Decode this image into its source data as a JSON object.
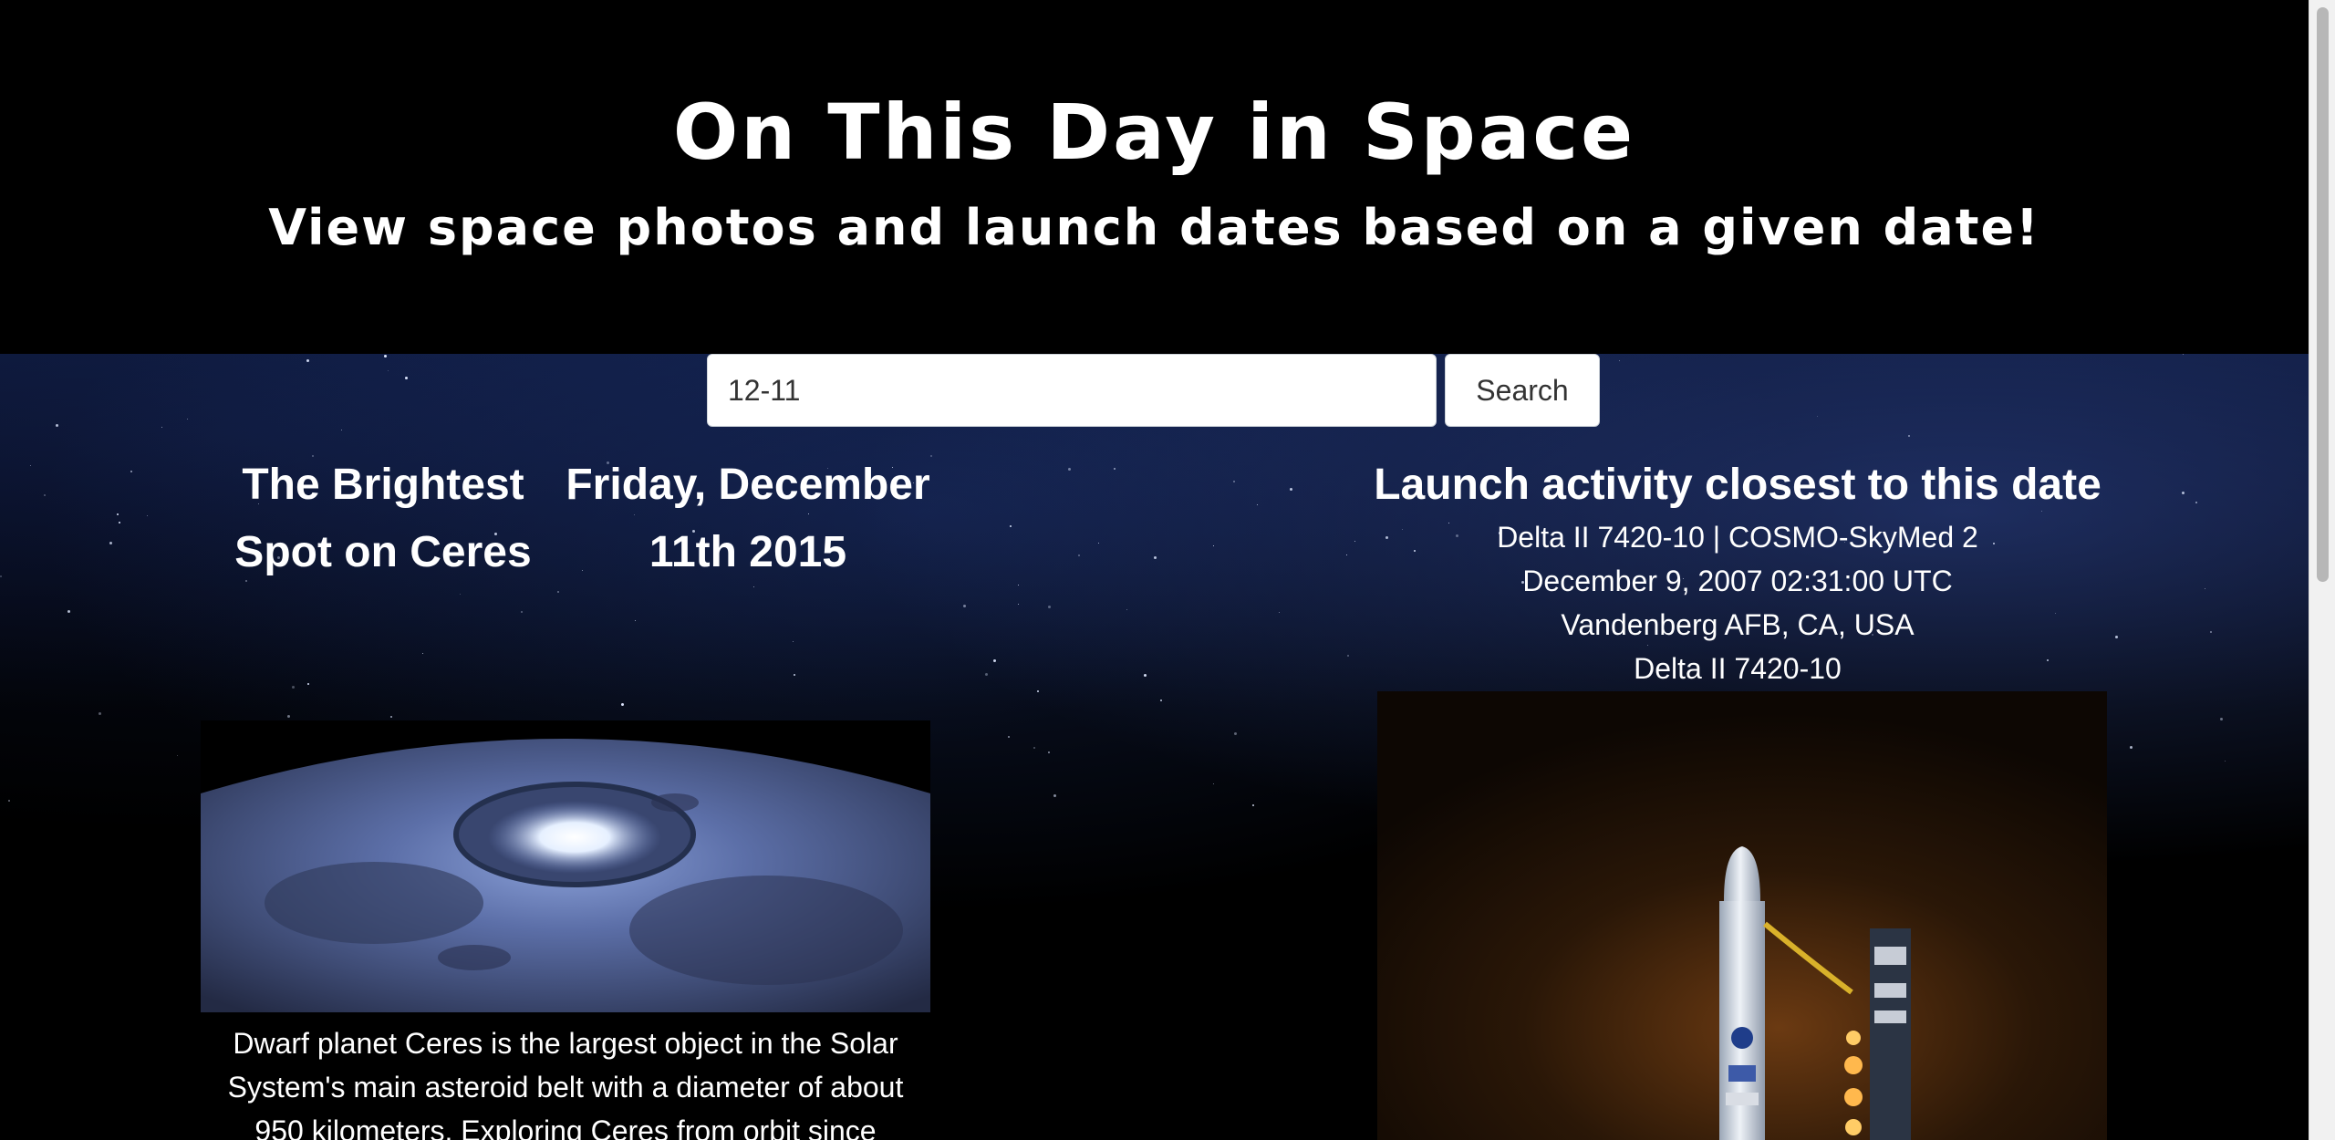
{
  "header": {
    "title": "On This Day in Space",
    "subtitle": "View space photos and launch dates based on a given date!"
  },
  "search": {
    "value": "12-11",
    "button_label": "Search"
  },
  "photo": {
    "title_line1": "The Brightest",
    "title_line2": "Spot on Ceres",
    "date_line1": "Friday, December",
    "date_line2": "11th 2015",
    "explanation": "Dwarf planet Ceres is the largest object in the Solar System's main asteroid belt with a diameter of about 950 kilometers. Exploring Ceres from orbit since"
  },
  "launch": {
    "heading": "Launch activity closest to this date",
    "name": "Delta II 7420-10 | COSMO-SkyMed 2",
    "datetime": "December 9, 2007 02:31:00 UTC",
    "location": "Vandenberg AFB, CA, USA",
    "rocket": "Delta II 7420-10"
  },
  "icons": {
    "scroll": "scrollbar"
  }
}
